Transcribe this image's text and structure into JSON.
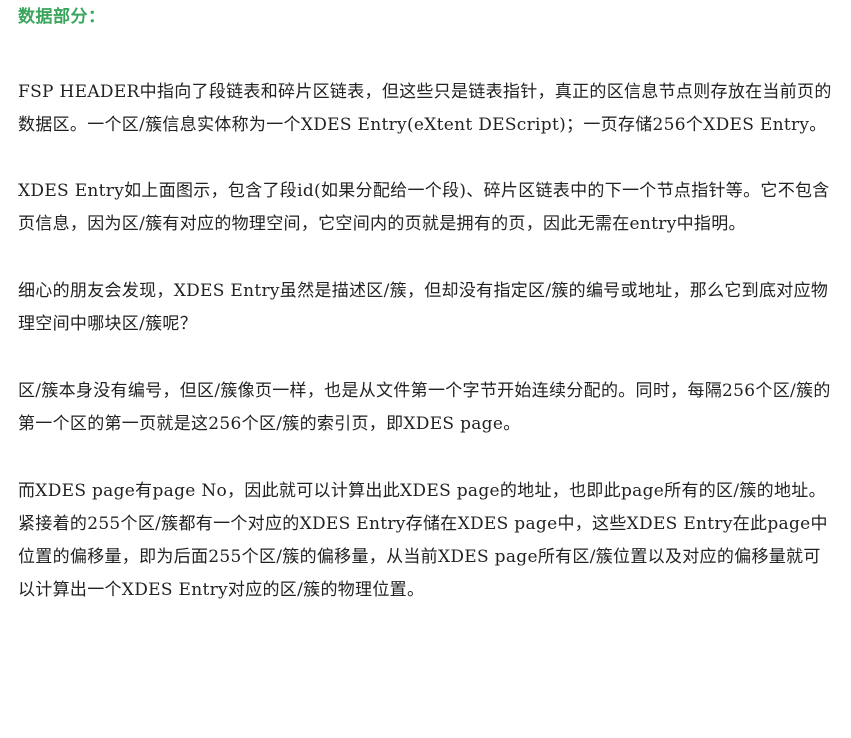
{
  "heading": {
    "text": "数据部分：",
    "color": "#3aa55c"
  },
  "paragraphs": [
    "FSP HEADER中指向了段链表和碎片区链表，但这些只是链表指针，真正的区信息节点则存放在当前页的数据区。一个区/簇信息实体称为一个XDES Entry(eXtent DEScript)；一页存储256个XDES Entry。",
    "XDES Entry如上面图示，包含了段id(如果分配给一个段)、碎片区链表中的下一个节点指针等。它不包含页信息，因为区/簇有对应的物理空间，它空间内的页就是拥有的页，因此无需在entry中指明。",
    "细心的朋友会发现，XDES Entry虽然是描述区/簇，但却没有指定区/簇的编号或地址，那么它到底对应物理空间中哪块区/簇呢？",
    "区/簇本身没有编号，但区/簇像页一样，也是从文件第一个字节开始连续分配的。同时，每隔256个区/簇的第一个区的第一页就是这256个区/簇的索引页，即XDES page。",
    "而XDES page有page No，因此就可以计算出此XDES page的地址，也即此page所有的区/簇的地址。紧接着的255个区/簇都有一个对应的XDES Entry存储在XDES page中，这些XDES Entry在此page中位置的偏移量，即为后面255个区/簇的偏移量，从当前XDES page所有区/簇位置以及对应的偏移量就可以计算出一个XDES Entry对应的区/簇的物理位置。"
  ],
  "colors": {
    "text": "#222222",
    "background": "#ffffff"
  }
}
